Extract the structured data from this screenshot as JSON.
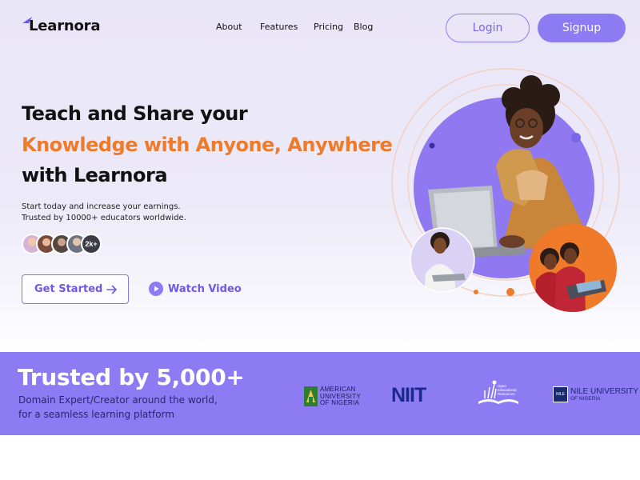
{
  "brand": {
    "name": "Learnora",
    "accent": "#8c7bf3",
    "highlight": "#ee7a2a"
  },
  "nav": {
    "items": [
      {
        "label": "About"
      },
      {
        "label": "Features"
      },
      {
        "label": "Pricing"
      },
      {
        "label": "Blog"
      }
    ],
    "login_label": "Login",
    "signup_label": "Signup"
  },
  "hero": {
    "headline_line1": "Teach and Share your",
    "headline_line2": "Knowledge with Anyone, Anywhere",
    "headline_line3": "with Learnora",
    "subtext_line1": "Start today and increase your earnings.",
    "subtext_line2": "Trusted by 10000+ educators worldwide.",
    "educator_count_badge": "2k+",
    "cta_primary_label": "Get Started",
    "cta_secondary_label": "Watch Video"
  },
  "trust": {
    "title": "Trusted by 5,000+",
    "subtitle_line1": "Domain Expert/Creator around the world,",
    "subtitle_line2": "for a seamless learning platform",
    "partners": {
      "aun_line1": "AMERICAN",
      "aun_line2": "UNIVERSITY",
      "aun_line3": "OF NIGERIA",
      "niit": "NIIT",
      "oer_text": "Open Educational Resources",
      "nile_box": "NILE",
      "nile_name": "NILE UNIVERSITY",
      "nile_sub": "OF NIGERIA"
    }
  }
}
